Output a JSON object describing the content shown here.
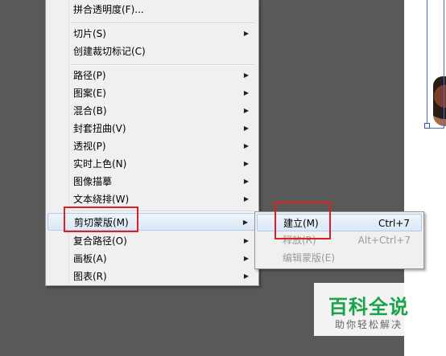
{
  "menu": {
    "items": [
      {
        "label": "拼合透明度(F)...",
        "submenu": false
      },
      {
        "label": "切片(S)",
        "submenu": true
      },
      {
        "label": "创建裁切标记(C)",
        "submenu": false
      },
      {
        "label": "路径(P)",
        "submenu": true
      },
      {
        "label": "图案(E)",
        "submenu": true
      },
      {
        "label": "混合(B)",
        "submenu": true
      },
      {
        "label": "封套扭曲(V)",
        "submenu": true
      },
      {
        "label": "透视(P)",
        "submenu": true
      },
      {
        "label": "实时上色(N)",
        "submenu": true
      },
      {
        "label": "图像描摹",
        "submenu": true
      },
      {
        "label": "文本绕排(W)",
        "submenu": true
      },
      {
        "label": "剪切蒙版(M)",
        "submenu": true,
        "highlighted": true
      },
      {
        "label": "复合路径(O)",
        "submenu": true
      },
      {
        "label": "画板(A)",
        "submenu": true
      },
      {
        "label": "图表(R)",
        "submenu": true
      }
    ],
    "arrow_glyph": "▶"
  },
  "submenu": {
    "items": [
      {
        "label": "建立(M)",
        "shortcut": "Ctrl+7",
        "enabled": true,
        "highlighted": true
      },
      {
        "label": "释放(R)",
        "shortcut": "Alt+Ctrl+7",
        "enabled": false
      },
      {
        "label": "编辑蒙版(E)",
        "shortcut": "",
        "enabled": false
      }
    ]
  },
  "watermark": {
    "title": "百科全说",
    "subtitle": "助你轻松解决"
  },
  "colors": {
    "canvas": "#595959",
    "highlight_box": "#e02020",
    "watermark_green": "#1aa34a"
  }
}
